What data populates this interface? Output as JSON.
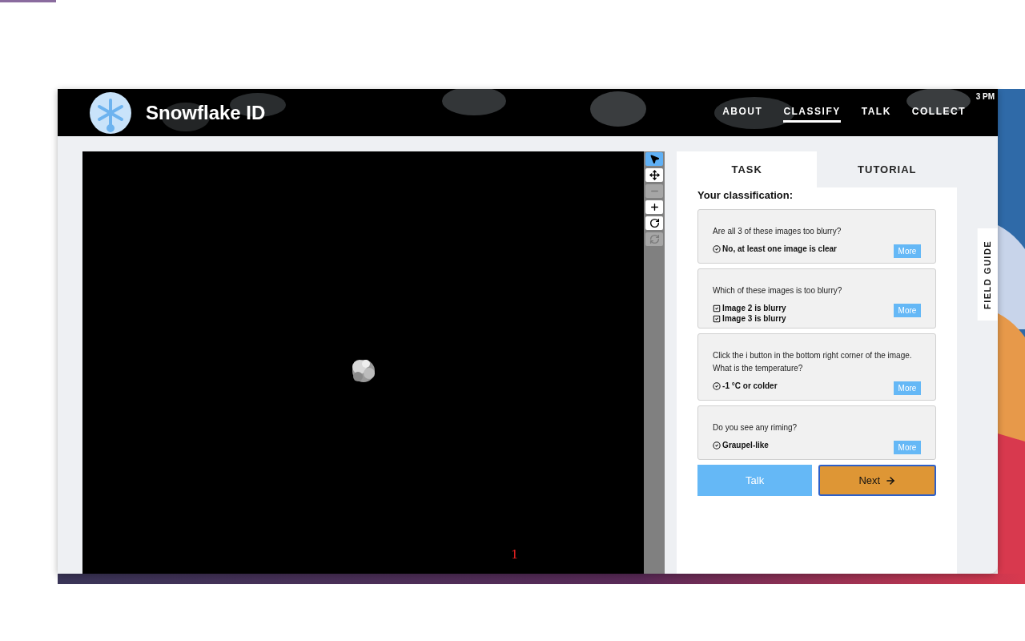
{
  "header": {
    "title": "Snowflake ID",
    "nav": [
      {
        "label": "ABOUT",
        "selected": false
      },
      {
        "label": "CLASSIFY",
        "selected": true
      },
      {
        "label": "TALK",
        "selected": false
      },
      {
        "label": "COLLECT",
        "selected": false
      }
    ],
    "clock": "3 PM"
  },
  "viewer": {
    "frame_label": "1",
    "tools": [
      {
        "kind": "pointer",
        "selected": true,
        "disabled": false
      },
      {
        "kind": "move",
        "selected": false,
        "disabled": false
      },
      {
        "kind": "zoom-out",
        "selected": false,
        "disabled": true
      },
      {
        "kind": "zoom-in",
        "selected": false,
        "disabled": false
      },
      {
        "kind": "rotate",
        "selected": false,
        "disabled": false
      },
      {
        "kind": "reset",
        "selected": false,
        "disabled": true
      }
    ]
  },
  "tabs": [
    {
      "label": "TASK",
      "selected": true
    },
    {
      "label": "TUTORIAL",
      "selected": false
    }
  ],
  "summary_title": "Your classification:",
  "questions": [
    {
      "question": "Are all 3 of these images too blurry?",
      "kind": "single",
      "answers": [
        "No, at least one image is clear"
      ],
      "more": "More"
    },
    {
      "question": "Which of these images is too blurry?",
      "kind": "multiple",
      "answers": [
        "Image 2 is blurry",
        "Image 3 is blurry"
      ],
      "more": "More"
    },
    {
      "question": "Click the i button in the bottom right corner of the image. What is the temperature?",
      "kind": "single",
      "answers": [
        "-1 °C or colder"
      ],
      "more": "More"
    },
    {
      "question": "Do you see any riming?",
      "kind": "single",
      "answers": [
        "Graupel-like"
      ],
      "more": "More"
    }
  ],
  "actions": {
    "talk": "Talk",
    "next": "Next"
  },
  "field_guide": "FIELD GUIDE"
}
